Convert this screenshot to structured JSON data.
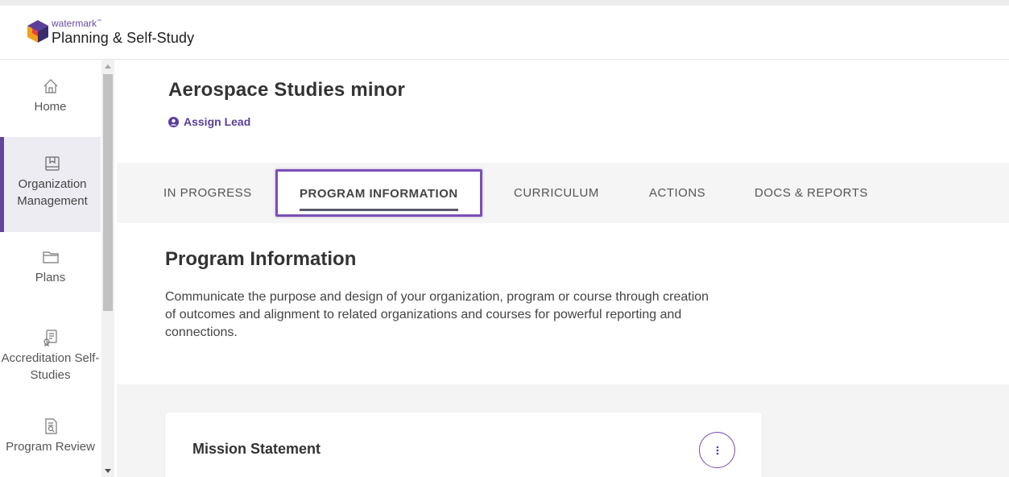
{
  "brand": {
    "small": "watermark",
    "tm": "™",
    "title": "Planning & Self-Study"
  },
  "sidebar": {
    "items": [
      {
        "label": "Home",
        "icon": "home-icon",
        "active": false
      },
      {
        "label": "Organization Management",
        "icon": "book-icon",
        "active": true
      },
      {
        "label": "Plans",
        "icon": "folder-icon",
        "active": false
      },
      {
        "label": "Accreditation Self-Studies",
        "icon": "certificate-icon",
        "active": false
      },
      {
        "label": "Program Review",
        "icon": "review-document-icon",
        "active": false
      }
    ]
  },
  "page": {
    "title": "Aerospace Studies minor",
    "assign_lead": "Assign Lead"
  },
  "tabs": [
    {
      "label": "IN PROGRESS",
      "active": false
    },
    {
      "label": "PROGRAM INFORMATION",
      "active": true
    },
    {
      "label": "CURRICULUM",
      "active": false
    },
    {
      "label": "ACTIONS",
      "active": false
    },
    {
      "label": "DOCS & REPORTS",
      "active": false
    }
  ],
  "info": {
    "title": "Program Information",
    "description": "Communicate the purpose and design of your organization, program or course through creation of outcomes and alignment to related organizations and courses for powerful reporting and connections."
  },
  "card": {
    "title": "Mission Statement"
  },
  "colors": {
    "accent": "#62459b",
    "tab_border": "#7a4fb5",
    "background": "#f4f4f4"
  }
}
